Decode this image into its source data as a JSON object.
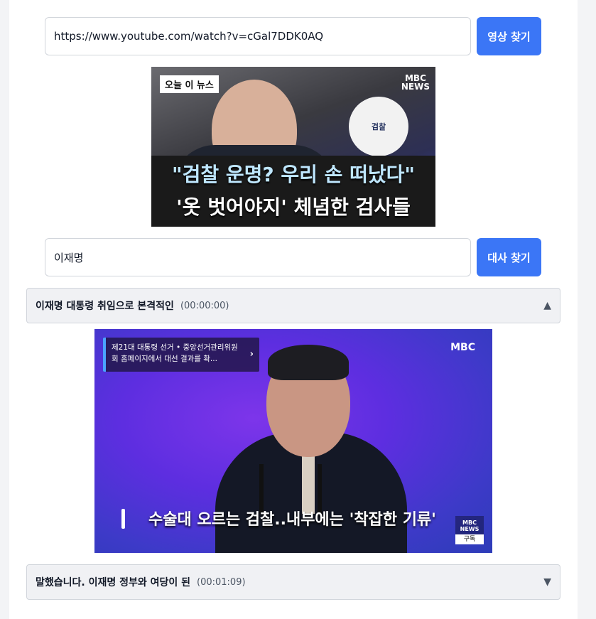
{
  "video_search": {
    "url_value": "https://www.youtube.com/watch?v=cGal7DDK0AQ",
    "button_label": "영상 찾기"
  },
  "thumbnail": {
    "tag": "오늘 이 뉴스",
    "logo_line1": "MBC",
    "logo_line2": "NEWS",
    "seal_text": "검찰",
    "headline_1": "\"검찰 운명? 우리 손 떠났다\"",
    "headline_2": "'옷 벗어야지' 체념한 검사들"
  },
  "line_search": {
    "query_value": "이재명",
    "button_label": "대사 찾기"
  },
  "results": [
    {
      "title": "이재명 대통령 취임으로 본격적인",
      "time": "(00:00:00)",
      "arrow": "▲",
      "expanded": true,
      "video": {
        "logo": "MBC",
        "info_card": "제21대 대통령 선거 • 중앙선거관리위원회 홈페이지에서 대선 결과를 확...",
        "info_chevron": "›",
        "caption": "수술대 오르는 검찰..내부에는 '착잡한 기류'",
        "badge_logo_1": "MBC",
        "badge_logo_2": "NEWS",
        "badge_label": "구독"
      }
    },
    {
      "title": "말했습니다. 이재명 정부와 여당이 된",
      "time": "(00:01:09)",
      "arrow": "▼",
      "expanded": false
    }
  ],
  "colors": {
    "primary_button": "#3b76f6",
    "accordion_bg": "#f0f1f4"
  }
}
